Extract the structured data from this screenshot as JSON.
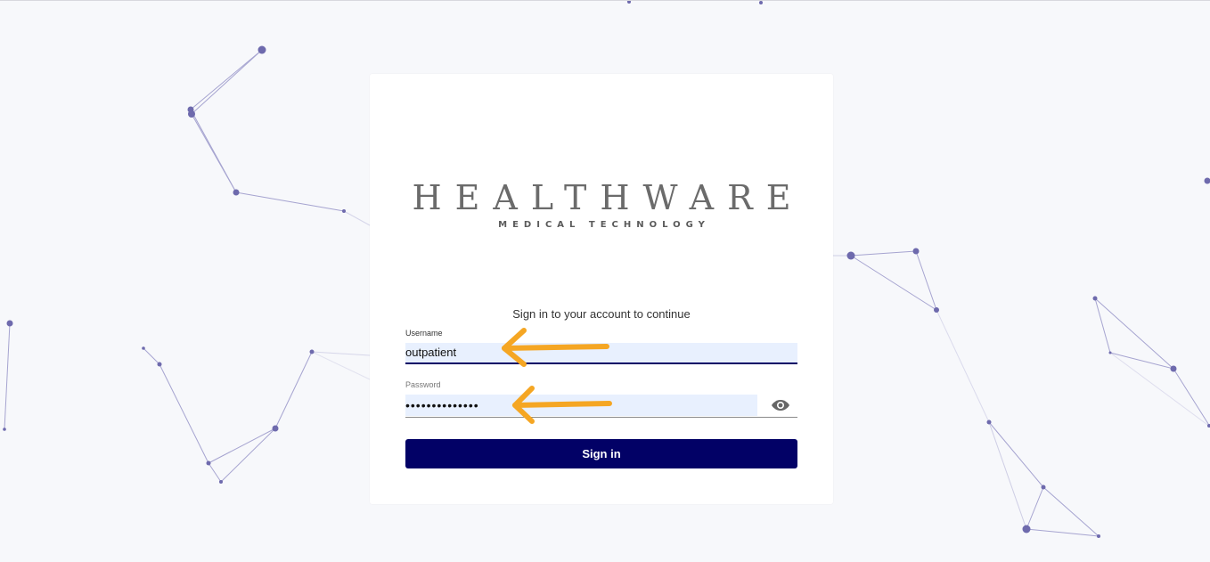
{
  "brand": {
    "name": "HEALTHWARE",
    "tagline": "MEDICAL TECHNOLOGY"
  },
  "login": {
    "subtitle": "Sign in to your account to continue",
    "username_label": "Username",
    "username_value": "outpatient",
    "password_label": "Password",
    "password_masked": "••••••••••••••",
    "show_password_icon": "eye-icon",
    "submit_label": "Sign in"
  },
  "colors": {
    "page_background": "#f7f8fb",
    "card_background": "#ffffff",
    "primary": "#020166",
    "autofill_background": "#e8f0fe",
    "network_nodes": "#6e6aad",
    "annotation_arrows": "#f5a623"
  }
}
